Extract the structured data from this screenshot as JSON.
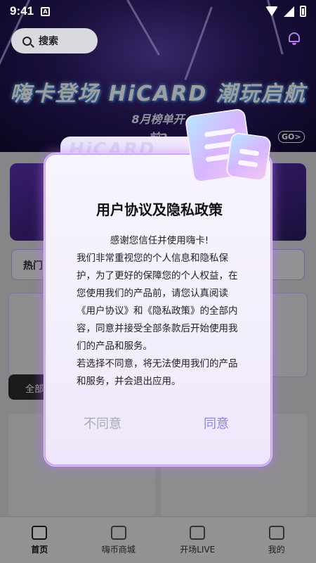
{
  "status_bar": {
    "time": "9:41",
    "nfc_label": "A"
  },
  "search": {
    "label": "搜索"
  },
  "banner": {
    "headline": "嗨卡登场 HiCARD 潮玩启航",
    "line2": "8月榜单开",
    "line3": "前2",
    "go_label": "GO>"
  },
  "page": {
    "hot_label": "热门",
    "all_tab": "全部"
  },
  "dialog": {
    "title": "用户协议及隐私政策",
    "back_text": "HiCARD",
    "greeting": "感谢您信任并使用嗨卡!",
    "paragraph1": "我们非常重视您的个人信息和隐私保护，为了更好的保障您的个人权益，在您使用我们的产品前，请您认真阅读《用户协议》和《隐私政策》的全部内容，同意并接受全部条款后开始使用我们的产品和服务。",
    "paragraph2": "若选择不同意，将无法使用我们的产品和服务，并会退出应用。",
    "disagree_label": "不同意",
    "agree_label": "同意"
  },
  "tab_bar": {
    "items": [
      {
        "label": "首页",
        "icon": "home-icon"
      },
      {
        "label": "嗨币商城",
        "icon": "shop-icon"
      },
      {
        "label": "开场LIVE",
        "icon": "live-icon"
      },
      {
        "label": "我的",
        "icon": "profile-icon"
      }
    ]
  },
  "colors": {
    "accent": "#8a84e8",
    "muted": "#a9a9b3",
    "glow": "#c9a6ff"
  }
}
